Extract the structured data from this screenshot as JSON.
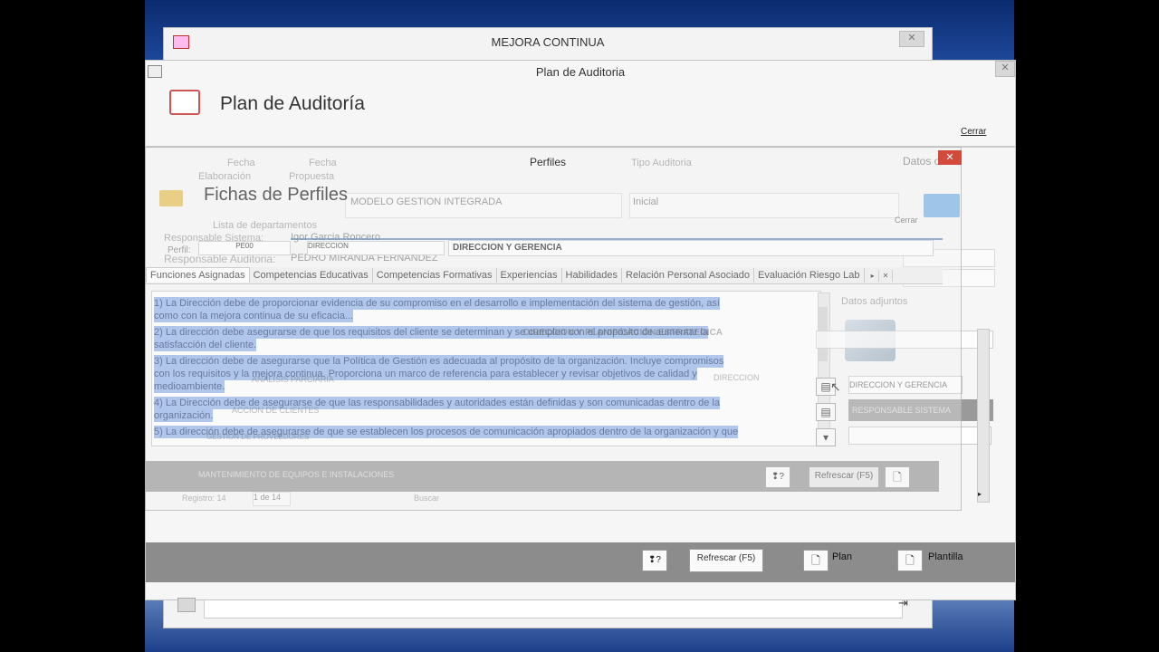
{
  "main_window": {
    "title": "MEJORA CONTINUA",
    "close": "✕"
  },
  "plan_window": {
    "title": "Plan de Auditoria",
    "header": "Plan de Auditoría",
    "close_link": "Cerrar",
    "close": "✕"
  },
  "perfiles_window": {
    "title": "Perfiles",
    "header": "Fichas de Perfiles",
    "close_btn": "Cerrar",
    "close": "✕"
  },
  "ghost": {
    "col_fecha": "Fecha",
    "col_elaboracion": "Elaboración",
    "col_fecha_propuesta": "Fecha",
    "col_propuesta": "Propuesta",
    "col_tipo": "Tipo Auditoria",
    "col_datos": "Datos otros:",
    "modelo": "MODELO GESTION INTEGRADA",
    "inicial": "Inicial",
    "lista_deptos": "Lista de departamentos",
    "resp_sistema_label": "Responsable Sistema:",
    "resp_sistema_value": "Igor Garcia Roncero",
    "resp_auditoria_label": "Responsable Auditoria:",
    "resp_auditoria_value": "PEDRO MIRANDA FERNANDEZ",
    "perfil_label": "Perfil:",
    "perfil_code": "PE00",
    "perfil_dept": "DIRECCION",
    "perfil_name": "DIRECCION Y GERENCIA",
    "plan_estrategica": "DIRECCION Y PLANIFICACION ESTRATEGICA",
    "item1": "ANALISIS PARCIARIA",
    "item2": "ACCION DE CLIENTES",
    "item3": "GESTION DE PROVEEDORES",
    "item4": "MANTENIMIENTO DE EQUIPOS E INSTALACIONES",
    "datos_adjuntos": "Datos adjuntos",
    "dir_field": "DIRECCION",
    "dir_gerencia": "DIRECCION Y GERENCIA",
    "resp_sistema_upper": "RESPONSABLE SISTEMA",
    "registro": "Registro: 14",
    "registro_of": "1 de 14",
    "buscar": "Buscar"
  },
  "tabs": [
    "Funciones Asignadas",
    "Competencias Educativas",
    "Competencias Formativas",
    "Experiencias",
    "Habilidades",
    "Relación Personal Asociado",
    "Evaluación Riesgo Lab"
  ],
  "functions": [
    "1) La Dirección debe de proporcionar evidencia de su compromiso en el desarrollo e implementación del sistema de gestión, así",
    "como con la mejora continua de su eficacia...",
    "2) La dirección debe asegurarse de que los requisitos del cliente se determinan y se cumplen con el propósito de aumentar la",
    "satisfacción del cliente.",
    "3) La dirección debe de asegurarse que la Política de Gestión es adecuada al propósito de la organización. Incluye compromisos",
    "con los requisitos y la mejora continua. Proporciona un marco de referencia para establecer y revisar objetivos de calidad y",
    "medioambiente.",
    "4) La Dirección debe de asegurarse de que las responsabilidades y autoridades están definidas y son comunicadas dentro de la",
    "organización.",
    "5) La dirección debe de asegurarse de que se establecen los procesos de comunicación apropiados dentro de la organización y que"
  ],
  "buttons": {
    "refresh": "Refrescar (F5)",
    "plan": "Plan",
    "plantilla": "Plantilla",
    "help_glyph": "❢?"
  }
}
